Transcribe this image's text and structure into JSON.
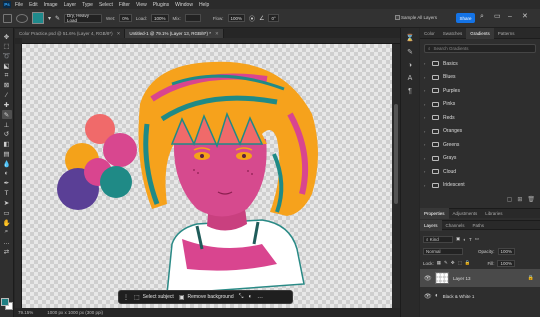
{
  "menubar": {
    "logo": "Ps",
    "items": [
      "File",
      "Edit",
      "Image",
      "Layer",
      "Type",
      "Select",
      "Filter",
      "View",
      "Plugins",
      "Window",
      "Help"
    ]
  },
  "options": {
    "brush_preset": "Dry, Heavy Load",
    "wet_label": "Wet:",
    "wet_value": "0%",
    "load_label": "Load:",
    "load_value": "100%",
    "mix_label": "Mix:",
    "flow_label": "Flow:",
    "flow_value": "100%",
    "angle_value": "0°",
    "sample_label": "Sample All Layers",
    "share_label": "Share",
    "swatch_color": "#1f8a8c"
  },
  "tabs": [
    {
      "label": "Color Practice.psd @ 51.6% (Layer 4, RGB/8*)",
      "active": false
    },
    {
      "label": "Untitled-1 @ 79.1% (Layer 13, RGB/8*) *",
      "active": true
    }
  ],
  "taskbar": {
    "select_subject": "Select subject",
    "remove_background": "Remove background"
  },
  "status": {
    "zoom": "79.15%",
    "doc_size": "1000 px x 1000 px (300 ppi)"
  },
  "gradients_panel": {
    "tabs": [
      "Color",
      "Swatches",
      "Gradients",
      "Patterns"
    ],
    "active_tab": "Gradients",
    "search_placeholder": "Search Gradients",
    "groups": [
      "Basics",
      "Blues",
      "Purples",
      "Pinks",
      "Reds",
      "Oranges",
      "Greens",
      "Grays",
      "Cloud",
      "Iridescent"
    ]
  },
  "properties_panel": {
    "tabs": [
      "Properties",
      "Adjustments",
      "Libraries"
    ]
  },
  "layers_panel": {
    "tabs": [
      "Layers",
      "Channels",
      "Paths"
    ],
    "filter_label": "Kind",
    "blend_mode": "Normal",
    "opacity_label": "Opacity:",
    "opacity_value": "100%",
    "lock_label": "Lock:",
    "fill_label": "Fill:",
    "fill_value": "100%",
    "layers": [
      {
        "name": "Layer 13",
        "selected": true
      },
      {
        "name": "Black & White 1",
        "selected": false
      }
    ]
  },
  "palette": {
    "coral": "#f06a6a",
    "pink": "#d8478f",
    "orange": "#f4a21a",
    "teal": "#1f8a86",
    "purple": "#5a3f96",
    "magenta": "#d9458f",
    "hair_orange": "#f6a21c",
    "accent_blue": "#1473e6"
  }
}
